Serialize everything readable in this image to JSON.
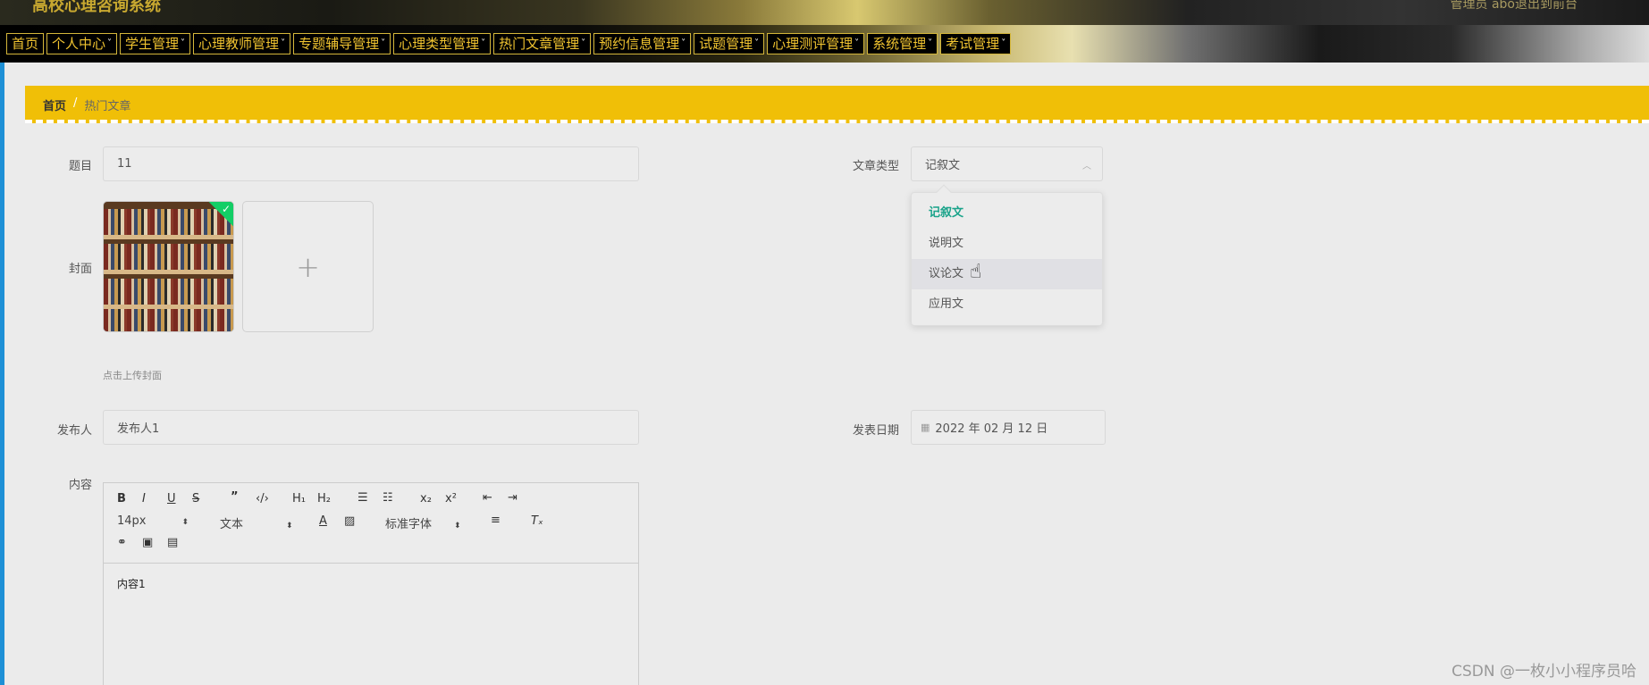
{
  "header": {
    "site_title": "高校心理咨询系统",
    "admin_label": "管理员 abo",
    "logout_label": "退出到前台"
  },
  "nav": {
    "items": [
      {
        "label": "首页",
        "has_arrow": false
      },
      {
        "label": "个人中心",
        "has_arrow": true
      },
      {
        "label": "学生管理",
        "has_arrow": true
      },
      {
        "label": "心理教师管理",
        "has_arrow": true
      },
      {
        "label": "专题辅导管理",
        "has_arrow": true
      },
      {
        "label": "心理类型管理",
        "has_arrow": true
      },
      {
        "label": "热门文章管理",
        "has_arrow": true
      },
      {
        "label": "预约信息管理",
        "has_arrow": true
      },
      {
        "label": "试题管理",
        "has_arrow": true
      },
      {
        "label": "心理测评管理",
        "has_arrow": true
      },
      {
        "label": "系统管理",
        "has_arrow": true
      },
      {
        "label": "考试管理",
        "has_arrow": true
      }
    ]
  },
  "breadcrumb": {
    "home": "首页",
    "separator": "/",
    "current": "热门文章"
  },
  "form": {
    "title_label": "题目",
    "title_value": "11",
    "type_label": "文章类型",
    "type_value": "记叙文",
    "cover_label": "封面",
    "upload_plus": "+",
    "cover_hint": "点击上传封面",
    "publisher_label": "发布人",
    "publisher_value": "发布人1",
    "date_label": "发表日期",
    "date_value": "2022 年 02 月 12 日",
    "content_label": "内容"
  },
  "dropdown": {
    "options": [
      "记叙文",
      "说明文",
      "议论文",
      "应用文"
    ],
    "selected": "记叙文",
    "hovered": "议论文"
  },
  "editor": {
    "font_size": "14px",
    "paragraph": "文本",
    "font_family": "标准字体",
    "content": "内容1"
  },
  "watermark": "CSDN @一枚小小程序员哈",
  "colors": {
    "accent": "#f0bf07",
    "nav_text": "#f0c330",
    "selected_option": "#1aa38a",
    "check_badge": "#13ce66"
  }
}
